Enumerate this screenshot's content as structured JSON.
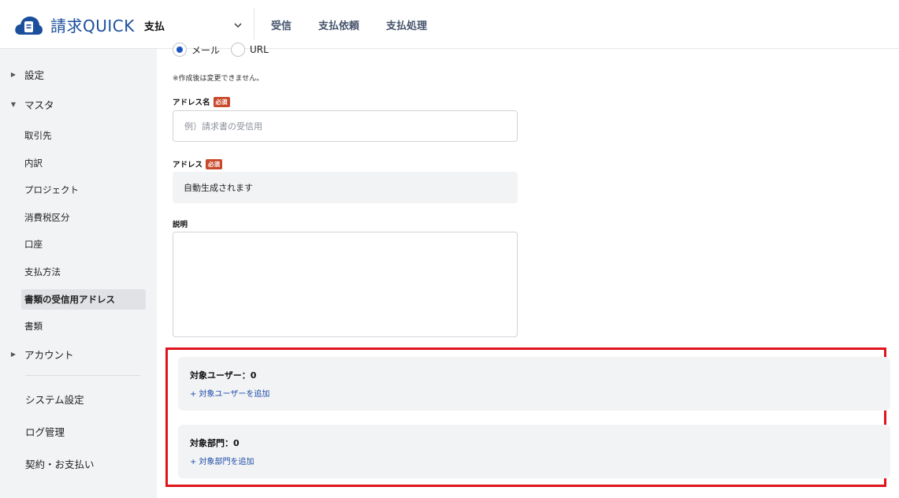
{
  "header": {
    "app_name": "請求QUICK",
    "module": "支払",
    "nav": [
      "受信",
      "支払依頼",
      "支払処理"
    ],
    "brand_color": "#1b4f9c"
  },
  "sidebar": {
    "settings": "設定",
    "master": "マスタ",
    "master_items": [
      "取引先",
      "内訳",
      "プロジェクト",
      "消費税区分",
      "口座",
      "支払方法",
      "書類の受信用アドレス",
      "書類"
    ],
    "active_item": "書類の受信用アドレス",
    "account": "アカウント",
    "system_settings": "システム設定",
    "log_management": "ログ管理",
    "contract_payment": "契約・お支払い"
  },
  "form": {
    "type_options": [
      "メール",
      "URL"
    ],
    "type_selected": "メール",
    "type_note": "※作成後は変更できません。",
    "address_name_label": "アドレス名",
    "required_badge": "必須",
    "address_name_placeholder": "例）請求書の受信用",
    "address_name_value": "",
    "address_label": "アドレス",
    "address_value": "自動生成されます",
    "description_label": "説明",
    "description_value": ""
  },
  "targets": {
    "users_title": "対象ユーザー：0",
    "users_add": "+ 対象ユーザーを追加",
    "departments_title": "対象部門：0",
    "departments_add": "+ 対象部門を追加",
    "highlight_color": "#e0141c"
  }
}
